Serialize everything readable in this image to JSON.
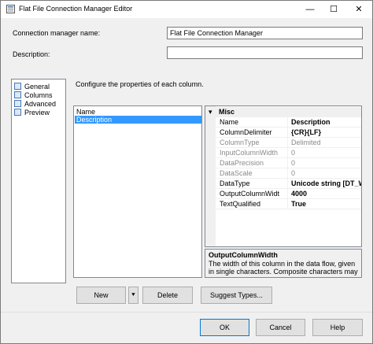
{
  "window": {
    "title": "Flat File Connection Manager Editor",
    "minimize_glyph": "—",
    "maximize_glyph": "☐",
    "close_glyph": "✕"
  },
  "form": {
    "connection_name_label": "Connection manager name:",
    "connection_name_value": "Flat File Connection Manager",
    "description_label": "Description:",
    "description_value": ""
  },
  "nav": {
    "items": [
      {
        "label": "General",
        "icon": "general-page-icon"
      },
      {
        "label": "Columns",
        "icon": "columns-page-icon"
      },
      {
        "label": "Advanced",
        "icon": "advanced-page-icon"
      },
      {
        "label": "Preview",
        "icon": "preview-page-icon"
      }
    ]
  },
  "main": {
    "instruction": "Configure the properties of each column."
  },
  "columns_list": {
    "items": [
      {
        "label": "Name"
      },
      {
        "label": "Description",
        "selected": true
      }
    ]
  },
  "properties": {
    "category_glyph": "▾",
    "category": "Misc",
    "rows": [
      {
        "name": "Name",
        "value": "Description",
        "readonly": false
      },
      {
        "name": "ColumnDelimiter",
        "value": "{CR}{LF}",
        "readonly": false
      },
      {
        "name": "ColumnType",
        "value": "Delimited",
        "readonly": true
      },
      {
        "name": "InputColumnWidth",
        "value": "0",
        "readonly": true
      },
      {
        "name": "DataPrecision",
        "value": "0",
        "readonly": true
      },
      {
        "name": "DataScale",
        "value": "0",
        "readonly": true
      },
      {
        "name": "DataType",
        "value": "Unicode string [DT_WSTR]",
        "readonly": false
      },
      {
        "name": "OutputColumnWidtl",
        "value": "4000",
        "readonly": false
      },
      {
        "name": "TextQualified",
        "value": "True",
        "readonly": false
      }
    ],
    "description_title": "OutputColumnWidth",
    "description_text": "The width of this column in the data flow, given in single characters. Composite characters may need t…"
  },
  "buttons": {
    "new": "New",
    "new_dropdown": "⯆",
    "delete": "Delete",
    "suggest_types": "Suggest Types...",
    "ok": "OK",
    "cancel": "Cancel",
    "help": "Help"
  }
}
